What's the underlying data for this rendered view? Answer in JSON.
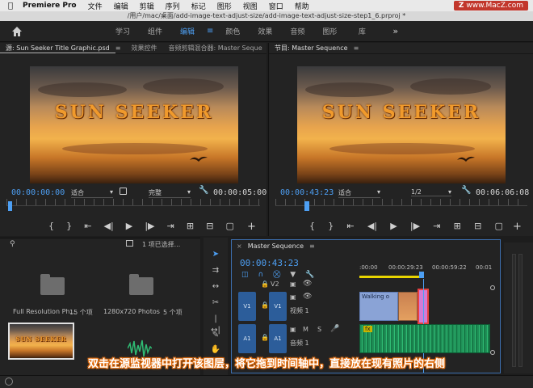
{
  "menubar": {
    "app_name": "Premiere Pro",
    "items": [
      "文件",
      "编辑",
      "剪辑",
      "序列",
      "标记",
      "图形",
      "视图",
      "窗口",
      "帮助"
    ],
    "watermark": "www.MacZ.com"
  },
  "window": {
    "title": "/用户/mac/桌面/add-image-text-adjust-size/add-image-text-adjust-size-step1_6.prproj *"
  },
  "workspaces": {
    "tabs": [
      "学习",
      "组件",
      "编辑",
      "颜色",
      "效果",
      "音频",
      "图形",
      "库"
    ],
    "active": "编辑",
    "more": "»"
  },
  "source_monitor": {
    "tabs": [
      "源: Sun Seeker Title Graphic.psd",
      "效果控件",
      "音频剪辑混合器: Master Seque"
    ],
    "more": "»",
    "video_title": "SUN SEEKER",
    "timecode_in": "00:00:00:00",
    "fit": "适合",
    "quality": "完整",
    "duration": "00:00:05:00"
  },
  "program_monitor": {
    "tab": "节目: Master Sequence",
    "video_title": "SUN SEEKER",
    "timecode": "00:00:43:23",
    "fit": "适合",
    "resolution": "1/2",
    "duration": "00:06:06:08"
  },
  "project": {
    "selection": "1 项已选择...",
    "items": [
      {
        "name": "Full Resolution Ph...",
        "count": "15 个项"
      },
      {
        "name": "1280x720 Photos",
        "count": "5 个项"
      }
    ]
  },
  "timeline": {
    "tab": "Master Sequence",
    "timecode": "00:00:43:23",
    "ruler": [
      ":00:00",
      "00:00:29:23",
      "00:00:59:22",
      "00:01"
    ],
    "tracks": {
      "v2": {
        "label": "V2"
      },
      "v1": {
        "label": "V1",
        "source": "V1",
        "name": "视频 1"
      },
      "a1": {
        "label": "A1",
        "source": "A1",
        "name": "音频 1",
        "m": "M",
        "s": "S"
      }
    },
    "clip_walking": "Walking o",
    "clip_fx": "fx"
  },
  "subtitle": "双击在源监视器中打开该图层，将它拖到时间轴中，直接放在现有照片的右侧",
  "colors": {
    "accent": "#4d9ff3",
    "subtitle_outline": "#e36b0a",
    "clip_video": "#8aa3d6",
    "clip_selected": "#d37bd6",
    "clip_audio": "#1f8f57"
  }
}
